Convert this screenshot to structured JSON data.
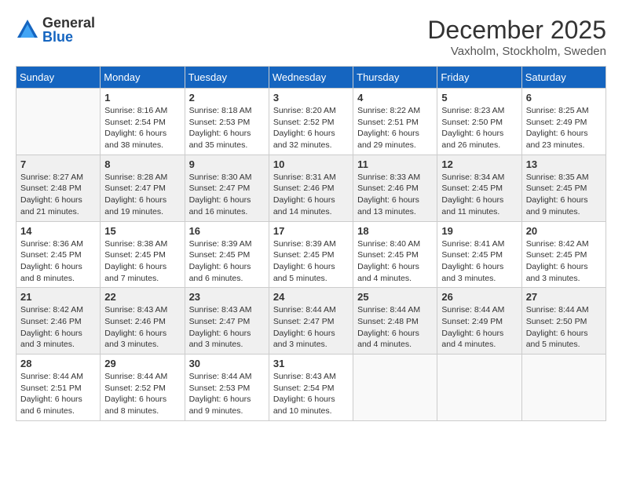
{
  "logo": {
    "general": "General",
    "blue": "Blue"
  },
  "title": "December 2025",
  "location": "Vaxholm, Stockholm, Sweden",
  "days_of_week": [
    "Sunday",
    "Monday",
    "Tuesday",
    "Wednesday",
    "Thursday",
    "Friday",
    "Saturday"
  ],
  "weeks": [
    [
      {
        "day": "",
        "info": ""
      },
      {
        "day": "1",
        "info": "Sunrise: 8:16 AM\nSunset: 2:54 PM\nDaylight: 6 hours\nand 38 minutes."
      },
      {
        "day": "2",
        "info": "Sunrise: 8:18 AM\nSunset: 2:53 PM\nDaylight: 6 hours\nand 35 minutes."
      },
      {
        "day": "3",
        "info": "Sunrise: 8:20 AM\nSunset: 2:52 PM\nDaylight: 6 hours\nand 32 minutes."
      },
      {
        "day": "4",
        "info": "Sunrise: 8:22 AM\nSunset: 2:51 PM\nDaylight: 6 hours\nand 29 minutes."
      },
      {
        "day": "5",
        "info": "Sunrise: 8:23 AM\nSunset: 2:50 PM\nDaylight: 6 hours\nand 26 minutes."
      },
      {
        "day": "6",
        "info": "Sunrise: 8:25 AM\nSunset: 2:49 PM\nDaylight: 6 hours\nand 23 minutes."
      }
    ],
    [
      {
        "day": "7",
        "info": "Sunrise: 8:27 AM\nSunset: 2:48 PM\nDaylight: 6 hours\nand 21 minutes."
      },
      {
        "day": "8",
        "info": "Sunrise: 8:28 AM\nSunset: 2:47 PM\nDaylight: 6 hours\nand 19 minutes."
      },
      {
        "day": "9",
        "info": "Sunrise: 8:30 AM\nSunset: 2:47 PM\nDaylight: 6 hours\nand 16 minutes."
      },
      {
        "day": "10",
        "info": "Sunrise: 8:31 AM\nSunset: 2:46 PM\nDaylight: 6 hours\nand 14 minutes."
      },
      {
        "day": "11",
        "info": "Sunrise: 8:33 AM\nSunset: 2:46 PM\nDaylight: 6 hours\nand 13 minutes."
      },
      {
        "day": "12",
        "info": "Sunrise: 8:34 AM\nSunset: 2:45 PM\nDaylight: 6 hours\nand 11 minutes."
      },
      {
        "day": "13",
        "info": "Sunrise: 8:35 AM\nSunset: 2:45 PM\nDaylight: 6 hours\nand 9 minutes."
      }
    ],
    [
      {
        "day": "14",
        "info": "Sunrise: 8:36 AM\nSunset: 2:45 PM\nDaylight: 6 hours\nand 8 minutes."
      },
      {
        "day": "15",
        "info": "Sunrise: 8:38 AM\nSunset: 2:45 PM\nDaylight: 6 hours\nand 7 minutes."
      },
      {
        "day": "16",
        "info": "Sunrise: 8:39 AM\nSunset: 2:45 PM\nDaylight: 6 hours\nand 6 minutes."
      },
      {
        "day": "17",
        "info": "Sunrise: 8:39 AM\nSunset: 2:45 PM\nDaylight: 6 hours\nand 5 minutes."
      },
      {
        "day": "18",
        "info": "Sunrise: 8:40 AM\nSunset: 2:45 PM\nDaylight: 6 hours\nand 4 minutes."
      },
      {
        "day": "19",
        "info": "Sunrise: 8:41 AM\nSunset: 2:45 PM\nDaylight: 6 hours\nand 3 minutes."
      },
      {
        "day": "20",
        "info": "Sunrise: 8:42 AM\nSunset: 2:45 PM\nDaylight: 6 hours\nand 3 minutes."
      }
    ],
    [
      {
        "day": "21",
        "info": "Sunrise: 8:42 AM\nSunset: 2:46 PM\nDaylight: 6 hours\nand 3 minutes."
      },
      {
        "day": "22",
        "info": "Sunrise: 8:43 AM\nSunset: 2:46 PM\nDaylight: 6 hours\nand 3 minutes."
      },
      {
        "day": "23",
        "info": "Sunrise: 8:43 AM\nSunset: 2:47 PM\nDaylight: 6 hours\nand 3 minutes."
      },
      {
        "day": "24",
        "info": "Sunrise: 8:44 AM\nSunset: 2:47 PM\nDaylight: 6 hours\nand 3 minutes."
      },
      {
        "day": "25",
        "info": "Sunrise: 8:44 AM\nSunset: 2:48 PM\nDaylight: 6 hours\nand 4 minutes."
      },
      {
        "day": "26",
        "info": "Sunrise: 8:44 AM\nSunset: 2:49 PM\nDaylight: 6 hours\nand 4 minutes."
      },
      {
        "day": "27",
        "info": "Sunrise: 8:44 AM\nSunset: 2:50 PM\nDaylight: 6 hours\nand 5 minutes."
      }
    ],
    [
      {
        "day": "28",
        "info": "Sunrise: 8:44 AM\nSunset: 2:51 PM\nDaylight: 6 hours\nand 6 minutes."
      },
      {
        "day": "29",
        "info": "Sunrise: 8:44 AM\nSunset: 2:52 PM\nDaylight: 6 hours\nand 8 minutes."
      },
      {
        "day": "30",
        "info": "Sunrise: 8:44 AM\nSunset: 2:53 PM\nDaylight: 6 hours\nand 9 minutes."
      },
      {
        "day": "31",
        "info": "Sunrise: 8:43 AM\nSunset: 2:54 PM\nDaylight: 6 hours\nand 10 minutes."
      },
      {
        "day": "",
        "info": ""
      },
      {
        "day": "",
        "info": ""
      },
      {
        "day": "",
        "info": ""
      }
    ]
  ]
}
